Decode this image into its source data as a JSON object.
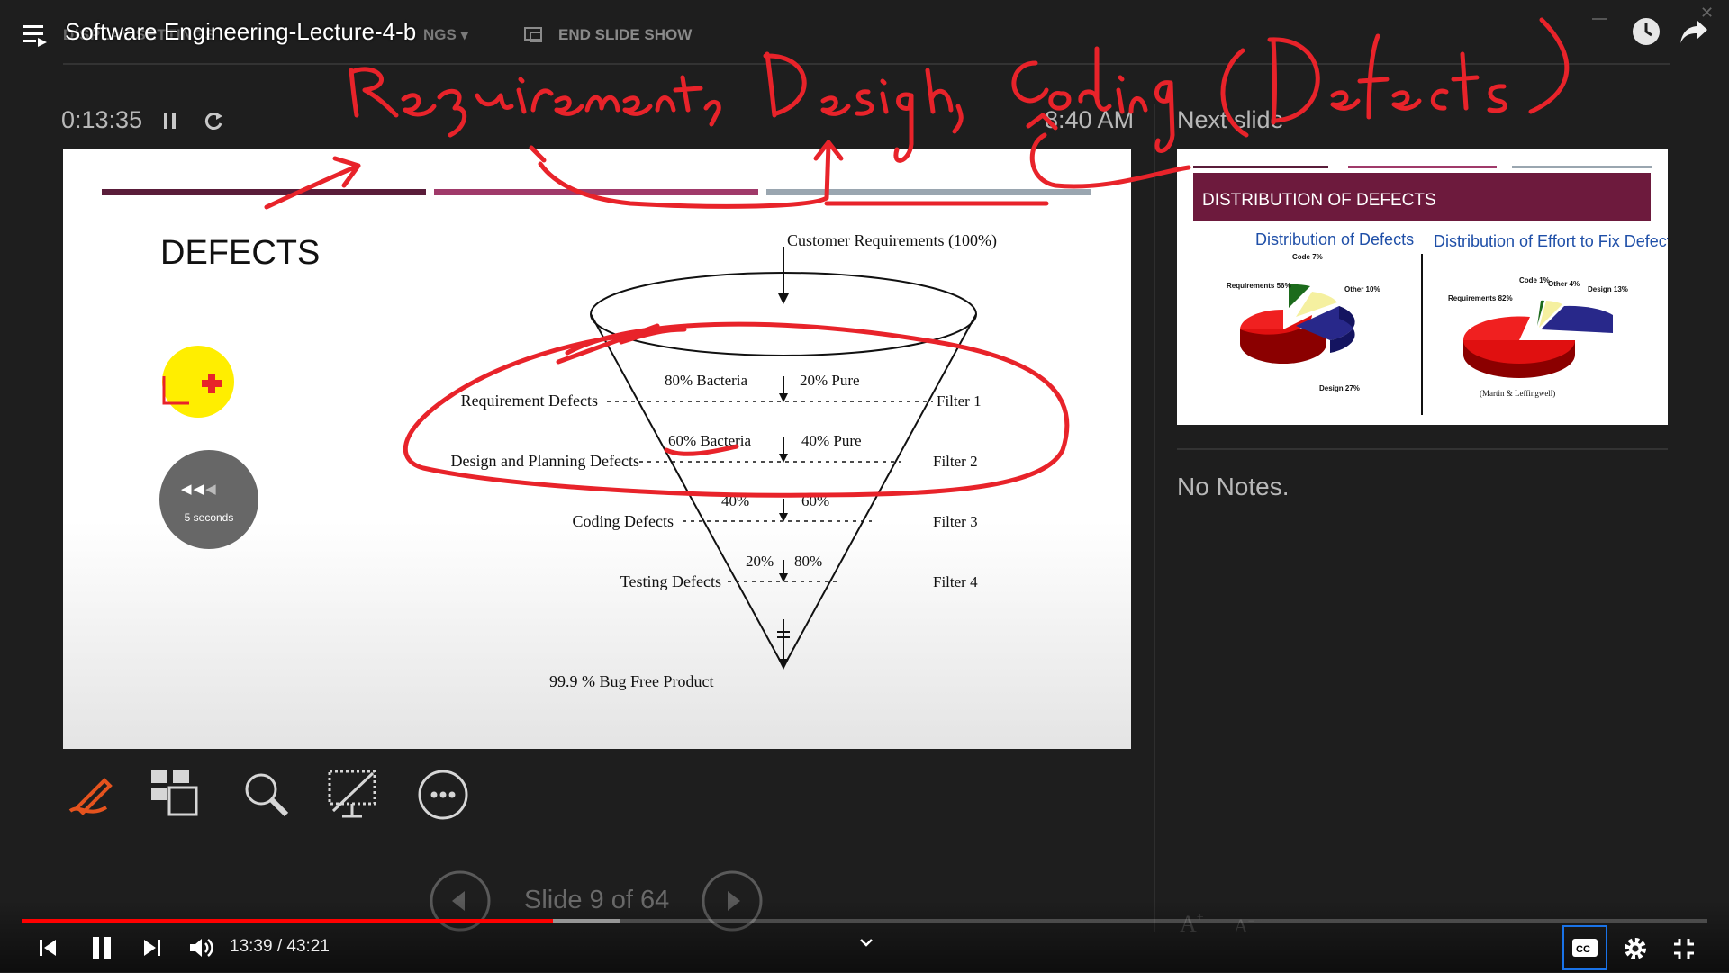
{
  "video": {
    "title": "Software Engineering-Lecture-4-b",
    "time_current": "13:39",
    "time_total": "43:21",
    "time_separator": "/",
    "progress": 0.315,
    "buffered": 0.355
  },
  "presenter": {
    "menu_ghost_left": "DISPLAY SETTINGS",
    "menu_ghost_right": "NGS ▾",
    "end_slide_show": "END SLIDE SHOW",
    "timer": "0:13:35",
    "clock": "8:40 AM",
    "next_slide_label": "Next slide",
    "notes": "No Notes.",
    "slide_counter": "Slide 9 of 64",
    "font_up": "A",
    "font_down": "A",
    "seek_overlay": "5 seconds"
  },
  "slide": {
    "title": "DEFECTS",
    "funnel_top": "Customer Requirements (100%)",
    "stages": [
      {
        "left": "Requirement Defects",
        "split_left": "80% Bacteria",
        "split_right": "20% Pure",
        "filter": "Filter 1"
      },
      {
        "left": "Design and Planning Defects",
        "split_left": "60% Bacteria",
        "split_right": "40% Pure",
        "filter": "Filter 2"
      },
      {
        "left": "Coding Defects",
        "split_left": "40%",
        "split_right": "60%",
        "filter": "Filter 3"
      },
      {
        "left": "Testing Defects",
        "split_left": "20%",
        "split_right": "80%",
        "filter": "Filter 4"
      }
    ],
    "bottom": "99.9 % Bug Free Product"
  },
  "next_slide": {
    "title": "DISTRIBUTION OF DEFECTS",
    "chart1_title": "Distribution of Defects",
    "chart1_labels": [
      "Requirements 56%",
      "Code 7%",
      "Other 10%",
      "Design 27%"
    ],
    "chart2_title": "Distribution of Effort to Fix Defects",
    "chart2_labels": [
      "Requirements 82%",
      "Code 1%",
      "Other 4%",
      "Design 13%"
    ],
    "source": "(Martin & Leffingwell)"
  },
  "annotation": {
    "handwriting": "Requirements, Design, Coding (Defects)"
  },
  "colors": {
    "background": "#1e1e1e",
    "ink": "#e8232a",
    "progress": "#ff0000",
    "slide_bar1": "#5a1d3a",
    "slide_bar2": "#a03a6a",
    "slide_bar3": "#9aa6b0",
    "next_header": "#6d1a3d"
  },
  "icons": [
    "menu-icon",
    "share-icon",
    "watch-later-icon",
    "pen-icon",
    "slides-grid-icon",
    "zoom-icon",
    "black-screen-icon",
    "more-icon",
    "prev-slide-icon",
    "next-slide-icon",
    "skip-back-icon",
    "pause-icon",
    "skip-next-icon",
    "volume-icon",
    "chevron-down-icon",
    "captions-icon",
    "settings-icon",
    "exit-fullscreen-icon",
    "rewind-icon"
  ]
}
